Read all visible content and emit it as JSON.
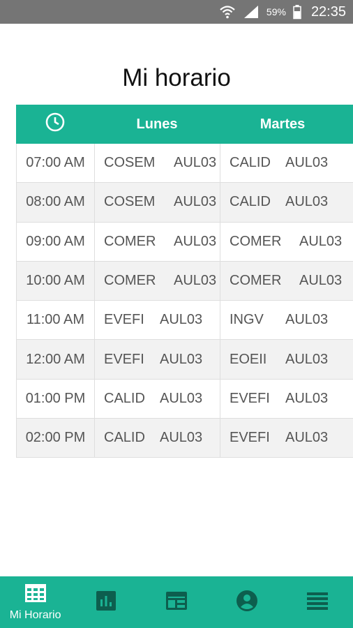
{
  "status_bar": {
    "battery_percent": "59%",
    "time": "22:35"
  },
  "page": {
    "title": "Mi horario"
  },
  "table": {
    "headers": {
      "time_icon": "clock-icon",
      "day1": "Lunes",
      "day2": "Martes"
    },
    "rows": [
      {
        "time": "07:00 AM",
        "day1_course": "COSEM",
        "day1_room": "AUL03",
        "day2_course": "CALID",
        "day2_room": "AUL03"
      },
      {
        "time": "08:00 AM",
        "day1_course": "COSEM",
        "day1_room": "AUL03",
        "day2_course": "CALID",
        "day2_room": "AUL03"
      },
      {
        "time": "09:00 AM",
        "day1_course": "COMER",
        "day1_room": "AUL03",
        "day2_course": "COMER",
        "day2_room": "AUL03"
      },
      {
        "time": "10:00 AM",
        "day1_course": "COMER",
        "day1_room": "AUL03",
        "day2_course": "COMER",
        "day2_room": "AUL03"
      },
      {
        "time": "11:00 AM",
        "day1_course": "EVEFI",
        "day1_room": "AUL03",
        "day2_course": "INGV",
        "day2_room": "AUL03"
      },
      {
        "time": "12:00 AM",
        "day1_course": "EVEFI",
        "day1_room": "AUL03",
        "day2_course": "EOEII",
        "day2_room": "AUL03"
      },
      {
        "time": "01:00 PM",
        "day1_course": "CALID",
        "day1_room": "AUL03",
        "day2_course": "EVEFI",
        "day2_room": "AUL03"
      },
      {
        "time": "02:00 PM",
        "day1_course": "CALID",
        "day1_room": "AUL03",
        "day2_course": "EVEFI",
        "day2_room": "AUL03"
      }
    ]
  },
  "bottom_nav": {
    "items": [
      {
        "icon": "calendar-grid-icon",
        "label": "Mi Horario",
        "active": true
      },
      {
        "icon": "bar-chart-icon",
        "label": "",
        "active": false
      },
      {
        "icon": "schedule-card-icon",
        "label": "",
        "active": false
      },
      {
        "icon": "account-circle-icon",
        "label": "",
        "active": false
      },
      {
        "icon": "menu-icon",
        "label": "",
        "active": false
      }
    ]
  },
  "colors": {
    "accent": "#1ab394",
    "accent_dark_icon": "#0d5e4e",
    "status_bar": "#757575"
  }
}
